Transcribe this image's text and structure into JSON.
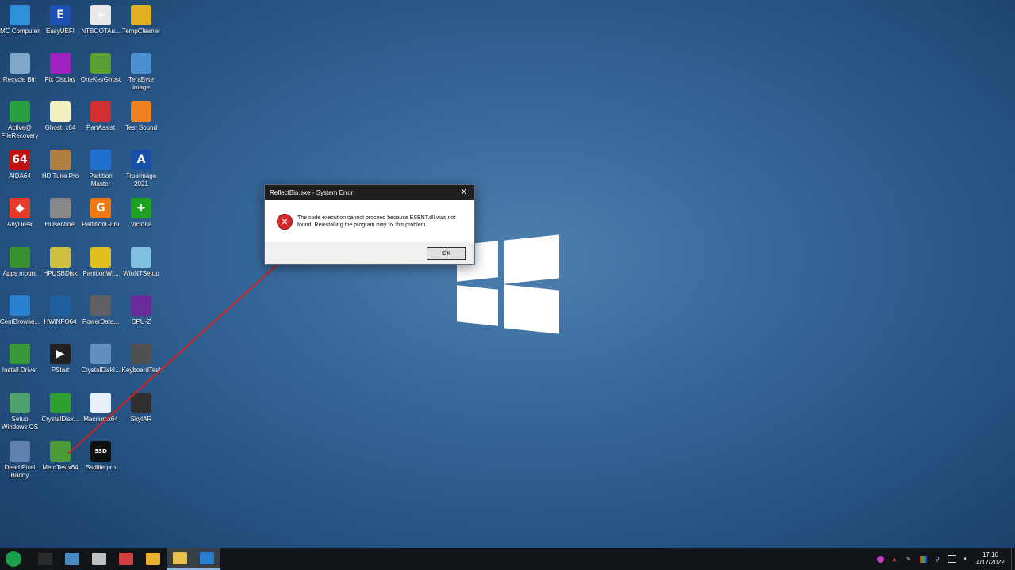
{
  "desktop": {
    "icons": [
      {
        "label": "MC Computer",
        "icon": "monitor-icon",
        "color": "#2f8fd8",
        "glyph": ""
      },
      {
        "label": "EasyUEFI",
        "icon": "easyuefi-icon",
        "color": "#1d4fb5",
        "glyph": "E"
      },
      {
        "label": "NTBOOTAu...",
        "icon": "first-aid-icon",
        "color": "#e8e8e8",
        "glyph": "+"
      },
      {
        "label": "TempCleaner",
        "icon": "broom-icon",
        "color": "#e0b020",
        "glyph": ""
      },
      {
        "label": "Recycle Bin",
        "icon": "recycle-bin-icon",
        "color": "#7fa7c8",
        "glyph": ""
      },
      {
        "label": "Fix Display",
        "icon": "color-display-icon",
        "color": "#a020c0",
        "glyph": ""
      },
      {
        "label": "OneKeyGhost",
        "icon": "ghost-icon",
        "color": "#5aa030",
        "glyph": ""
      },
      {
        "label": "TeraByte image",
        "icon": "terabyte-icon",
        "color": "#4a90d0",
        "glyph": ""
      },
      {
        "label": "Active@ FileRecovery",
        "icon": "file-recovery-icon",
        "color": "#2aa040",
        "glyph": ""
      },
      {
        "label": "Ghost_x64",
        "icon": "ghost-x64-icon",
        "color": "#f0f0c0",
        "glyph": ""
      },
      {
        "label": "PartAssist",
        "icon": "partassist-icon",
        "color": "#d03030",
        "glyph": ""
      },
      {
        "label": "Test Sound",
        "icon": "vlc-cone-icon",
        "color": "#f08020",
        "glyph": ""
      },
      {
        "label": "AIDA64",
        "icon": "aida64-icon",
        "color": "#c01010",
        "glyph": "64"
      },
      {
        "label": "HD Tune Pro",
        "icon": "hdtune-icon",
        "color": "#b08040",
        "glyph": ""
      },
      {
        "label": "Partition Master",
        "icon": "partition-master-icon",
        "color": "#2070d0",
        "glyph": ""
      },
      {
        "label": "TrueImage 2021",
        "icon": "trueimage-icon",
        "color": "#1a4fa8",
        "glyph": "A"
      },
      {
        "label": "AnyDesk",
        "icon": "anydesk-icon",
        "color": "#e83a2a",
        "glyph": "◆"
      },
      {
        "label": "HDsentinel",
        "icon": "hdsentinel-icon",
        "color": "#888888",
        "glyph": ""
      },
      {
        "label": "PartitionGuru",
        "icon": "partitionguru-icon",
        "color": "#f07a10",
        "glyph": "G"
      },
      {
        "label": "Victoria",
        "icon": "victoria-cross-icon",
        "color": "#20a020",
        "glyph": "+"
      },
      {
        "label": "Apps mount",
        "icon": "apps-mount-icon",
        "color": "#3a9030",
        "glyph": ""
      },
      {
        "label": "HPUSBDisk",
        "icon": "hpusbdisk-icon",
        "color": "#d0c040",
        "glyph": ""
      },
      {
        "label": "PartitionWi...",
        "icon": "partitionwizard-icon",
        "color": "#e0c020",
        "glyph": ""
      },
      {
        "label": "WinNTSetup",
        "icon": "winntsetup-icon",
        "color": "#80c0e0",
        "glyph": ""
      },
      {
        "label": "CentBrowse...",
        "icon": "centbrowser-icon",
        "color": "#2a80d0",
        "glyph": ""
      },
      {
        "label": "HWiNFO64",
        "icon": "hwinfo-icon",
        "color": "#2060a0",
        "glyph": ""
      },
      {
        "label": "PowerData...",
        "icon": "powerdata-icon",
        "color": "#606060",
        "glyph": ""
      },
      {
        "label": "CPU-Z",
        "icon": "cpuz-icon",
        "color": "#6a2a9a",
        "glyph": ""
      },
      {
        "label": "Install Driver",
        "icon": "install-driver-icon",
        "color": "#3a9a3a",
        "glyph": ""
      },
      {
        "label": "PStart",
        "icon": "pstart-play-icon",
        "color": "#202020",
        "glyph": "▶"
      },
      {
        "label": "CrystalDiskI...",
        "icon": "crystaldiskinfo-icon",
        "color": "#6090c0",
        "glyph": ""
      },
      {
        "label": "KeyboardTest",
        "icon": "keyboardtest-icon",
        "color": "#505050",
        "glyph": ""
      },
      {
        "label": "Setup Windows OS",
        "icon": "setup-windows-icon",
        "color": "#50a070",
        "glyph": ""
      },
      {
        "label": "CrystalDisk...",
        "icon": "crystaldiskmark-icon",
        "color": "#30a030",
        "glyph": ""
      },
      {
        "label": "Macriumx64",
        "icon": "macrium-icon",
        "color": "#e8f0ff",
        "glyph": ""
      },
      {
        "label": "SkyIAR",
        "icon": "skyiar-icon",
        "color": "#303030",
        "glyph": ""
      },
      {
        "label": "Dead Pixel Buddy",
        "icon": "laptop-icon",
        "color": "#6080b0",
        "glyph": ""
      },
      {
        "label": "MemTestx64",
        "icon": "memory-module-icon",
        "color": "#4a9a3a",
        "glyph": ""
      },
      {
        "label": "Ssdlife pro",
        "icon": "ssd-icon",
        "color": "#101010",
        "glyph": "SSD"
      }
    ]
  },
  "dialog": {
    "title": "ReflectBin.exe - System Error",
    "message": "The code execution cannot proceed because ESENT.dll was not found. Reinstalling the program may fix this problem.",
    "ok_label": "OK",
    "close_glyph": "✕",
    "error_glyph": "✕"
  },
  "annotation": {
    "arrow_color": "#d42020"
  },
  "taskbar": {
    "buttons": [
      {
        "icon": "start-orb-icon",
        "color": "#1aa04a",
        "active": false
      },
      {
        "icon": "command-prompt-icon",
        "color": "#2a2a2a",
        "active": false
      },
      {
        "icon": "remote-desktop-icon",
        "color": "#4a8ac0",
        "active": false
      },
      {
        "icon": "tools-icon",
        "color": "#c0c0c0",
        "active": false
      },
      {
        "icon": "task-manager-icon",
        "color": "#d04040",
        "active": false
      },
      {
        "icon": "file-explorer-icon",
        "color": "#e8b030",
        "active": false
      },
      {
        "icon": "folder-icon",
        "color": "#e8c050",
        "active": true
      },
      {
        "icon": "app-window-icon",
        "color": "#2a80d0",
        "active": true
      }
    ],
    "clock_time": "17:10",
    "clock_date": "4/17/2022"
  }
}
